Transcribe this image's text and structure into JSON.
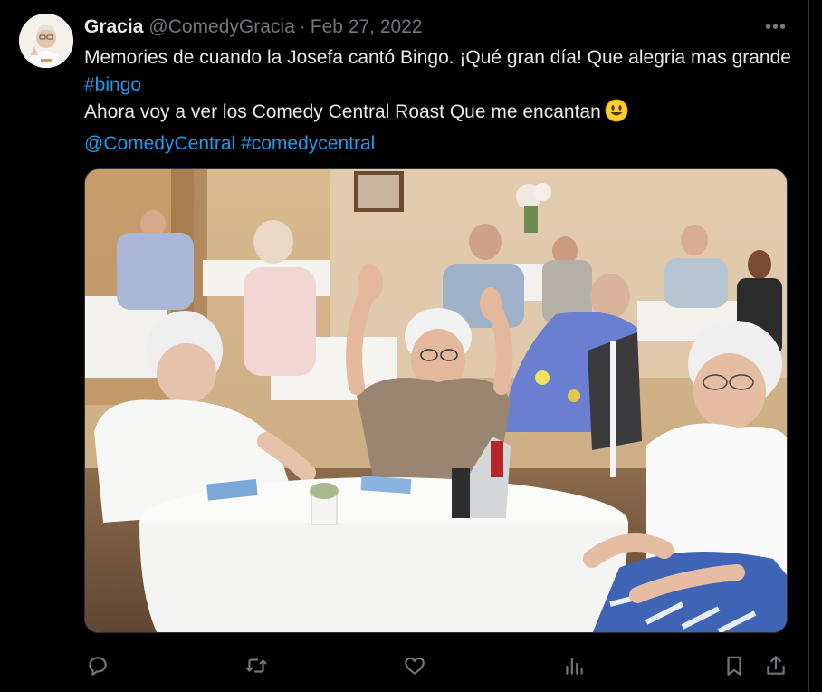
{
  "tweet": {
    "author_name": "Gracia",
    "handle": "@ComedyGracia",
    "separator": "·",
    "date": "Feb 27, 2022",
    "more_label": "•••",
    "line1": "Memories de cuando la Josefa cantó Bingo. ¡Qué gran día! Que alegria mas grande",
    "hashtag_bingo": "#bingo",
    "line2": "Ahora voy a ver los Comedy Central Roast Que me encantan",
    "mention": "@ComedyCentral",
    "hashtag_cc": "#comedycentral"
  },
  "actions": {
    "reply": "reply-icon",
    "retweet": "retweet-icon",
    "like": "heart-icon",
    "views": "views-icon",
    "bookmark": "bookmark-icon",
    "share": "share-icon"
  },
  "colors": {
    "background": "#000000",
    "text": "#e7e9ea",
    "muted": "#71767b",
    "link": "#1d9bf0"
  }
}
